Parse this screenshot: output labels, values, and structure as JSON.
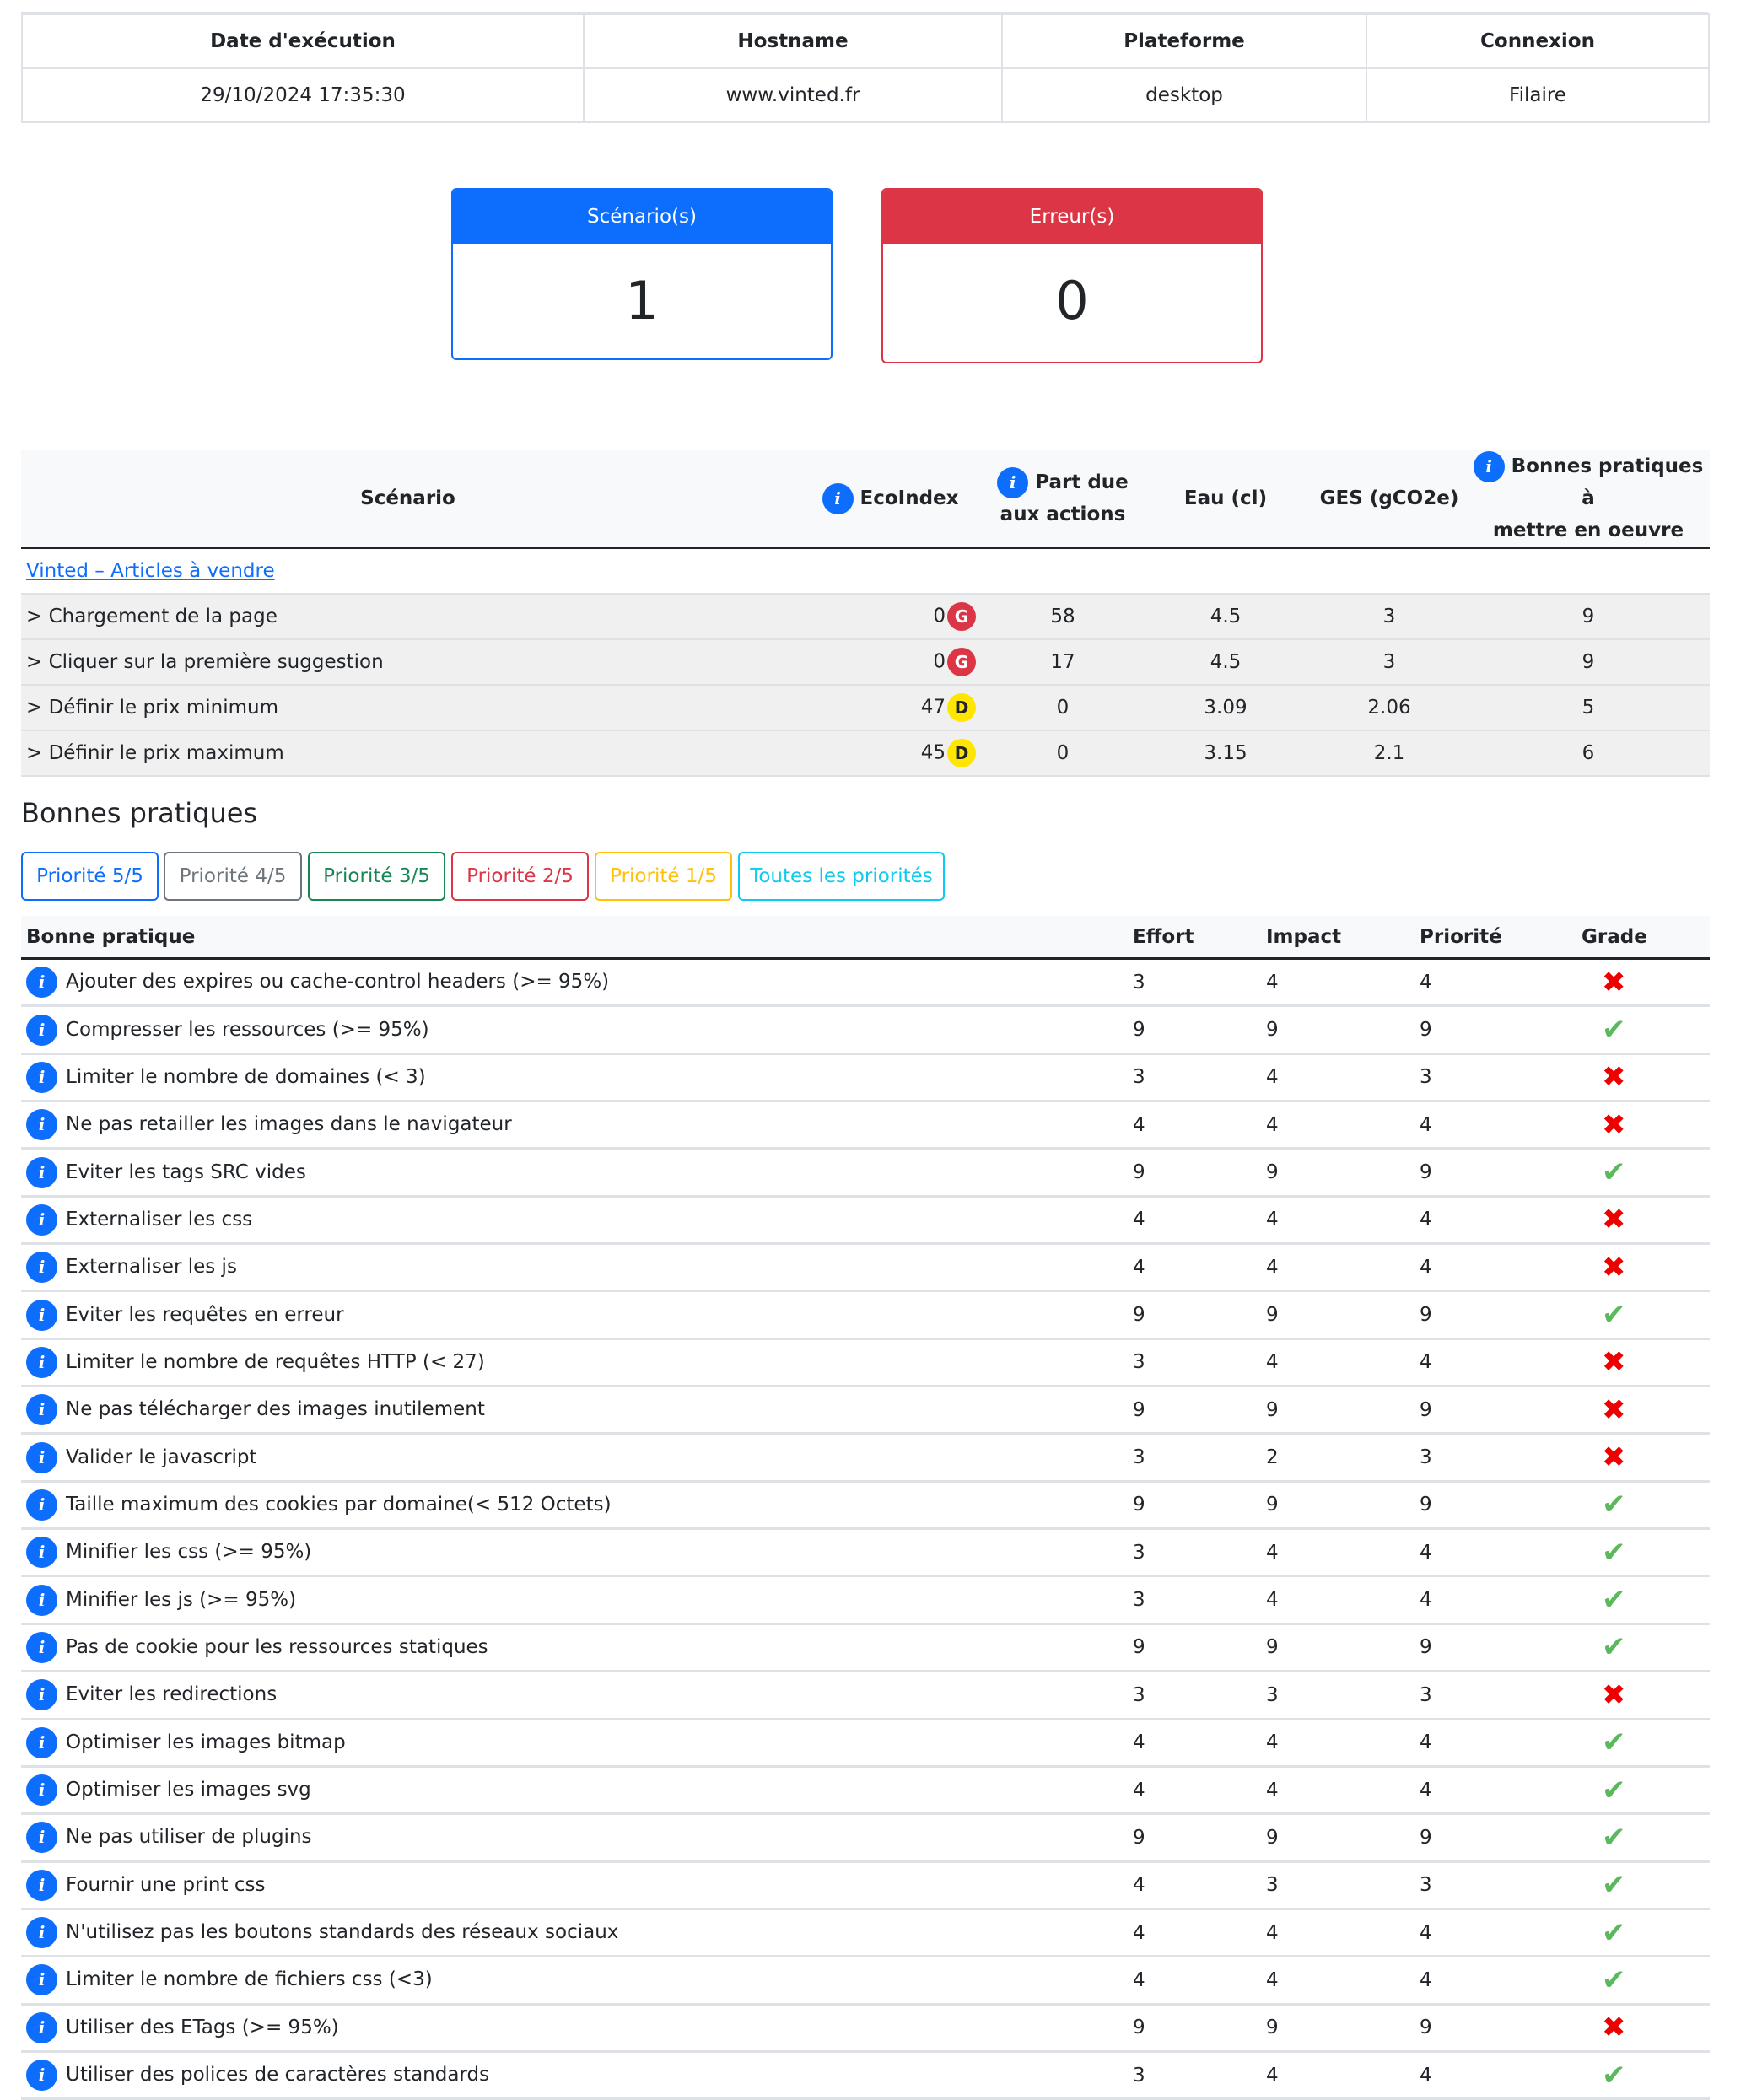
{
  "info": {
    "headers": [
      "Date d'exécution",
      "Hostname",
      "Plateforme",
      "Connexion"
    ],
    "values": [
      "29/10/2024 17:35:30",
      "www.vinted.fr",
      "desktop",
      "Filaire"
    ]
  },
  "counters": {
    "scenarios": {
      "label": "Scénario(s)",
      "value": "1",
      "color": "#0d6efd"
    },
    "errors": {
      "label": "Erreur(s)",
      "value": "0",
      "color": "#dc3545"
    }
  },
  "scenario_table": {
    "headers": {
      "scenario": "Scénario",
      "ecoindex": "EcoIndex",
      "part_line1": "Part due",
      "part_line2": "aux actions",
      "water": "Eau (cl)",
      "ges": "GES (gCO2e)",
      "bp_line1": "Bonnes pratiques à",
      "bp_line2": "mettre en oeuvre"
    },
    "scenario_name": "Vinted – Articles à vendre",
    "steps": [
      {
        "name": "> Chargement de la page",
        "ecoindex": "0",
        "grade": "G",
        "grade_color": "#dc3545",
        "part": "58",
        "water": "4.5",
        "ges": "3",
        "bp": "9"
      },
      {
        "name": "> Cliquer sur la première suggestion",
        "ecoindex": "0",
        "grade": "G",
        "grade_color": "#dc3545",
        "part": "17",
        "water": "4.5",
        "ges": "3",
        "bp": "9"
      },
      {
        "name": "> Définir le prix minimum",
        "ecoindex": "47",
        "grade": "D",
        "grade_color": "#ffe600",
        "part": "0",
        "water": "3.09",
        "ges": "2.06",
        "bp": "5"
      },
      {
        "name": "> Définir le prix maximum",
        "ecoindex": "45",
        "grade": "D",
        "grade_color": "#ffe600",
        "part": "0",
        "water": "3.15",
        "ges": "2.1",
        "bp": "6"
      }
    ]
  },
  "good_practices": {
    "title": "Bonnes pratiques",
    "filters": [
      {
        "label": "Priorité 5/5",
        "color": "#0d6efd"
      },
      {
        "label": "Priorité 4/5",
        "color": "#6c757d"
      },
      {
        "label": "Priorité 3/5",
        "color": "#198754"
      },
      {
        "label": "Priorité 2/5",
        "color": "#dc3545"
      },
      {
        "label": "Priorité 1/5",
        "color": "#ffc107"
      },
      {
        "label": "Toutes les priorités",
        "color": "#0dcaf0"
      }
    ],
    "headers": {
      "practice": "Bonne pratique",
      "effort": "Effort",
      "impact": "Impact",
      "priority": "Priorité",
      "grade": "Grade"
    },
    "rows": [
      {
        "name": "Ajouter des expires ou cache-control headers (>= 95%)",
        "effort": "3",
        "impact": "4",
        "priority": "4",
        "grade": "fail"
      },
      {
        "name": "Compresser les ressources (>= 95%)",
        "effort": "9",
        "impact": "9",
        "priority": "9",
        "grade": "ok"
      },
      {
        "name": "Limiter le nombre de domaines (< 3)",
        "effort": "3",
        "impact": "4",
        "priority": "3",
        "grade": "fail"
      },
      {
        "name": "Ne pas retailler les images dans le navigateur",
        "effort": "4",
        "impact": "4",
        "priority": "4",
        "grade": "fail"
      },
      {
        "name": "Eviter les tags SRC vides",
        "effort": "9",
        "impact": "9",
        "priority": "9",
        "grade": "ok"
      },
      {
        "name": "Externaliser les css",
        "effort": "4",
        "impact": "4",
        "priority": "4",
        "grade": "fail"
      },
      {
        "name": "Externaliser les js",
        "effort": "4",
        "impact": "4",
        "priority": "4",
        "grade": "fail"
      },
      {
        "name": "Eviter les requêtes en erreur",
        "effort": "9",
        "impact": "9",
        "priority": "9",
        "grade": "ok"
      },
      {
        "name": "Limiter le nombre de requêtes HTTP (< 27)",
        "effort": "3",
        "impact": "4",
        "priority": "4",
        "grade": "fail"
      },
      {
        "name": "Ne pas télécharger des images inutilement",
        "effort": "9",
        "impact": "9",
        "priority": "9",
        "grade": "fail"
      },
      {
        "name": "Valider le javascript",
        "effort": "3",
        "impact": "2",
        "priority": "3",
        "grade": "fail"
      },
      {
        "name": "Taille maximum des cookies par domaine(< 512 Octets)",
        "effort": "9",
        "impact": "9",
        "priority": "9",
        "grade": "ok"
      },
      {
        "name": "Minifier les css (>= 95%)",
        "effort": "3",
        "impact": "4",
        "priority": "4",
        "grade": "ok"
      },
      {
        "name": "Minifier les js (>= 95%)",
        "effort": "3",
        "impact": "4",
        "priority": "4",
        "grade": "ok"
      },
      {
        "name": "Pas de cookie pour les ressources statiques",
        "effort": "9",
        "impact": "9",
        "priority": "9",
        "grade": "ok"
      },
      {
        "name": "Eviter les redirections",
        "effort": "3",
        "impact": "3",
        "priority": "3",
        "grade": "fail"
      },
      {
        "name": "Optimiser les images bitmap",
        "effort": "4",
        "impact": "4",
        "priority": "4",
        "grade": "ok"
      },
      {
        "name": "Optimiser les images svg",
        "effort": "4",
        "impact": "4",
        "priority": "4",
        "grade": "ok"
      },
      {
        "name": "Ne pas utiliser de plugins",
        "effort": "9",
        "impact": "9",
        "priority": "9",
        "grade": "ok"
      },
      {
        "name": "Fournir une print css",
        "effort": "4",
        "impact": "3",
        "priority": "3",
        "grade": "ok"
      },
      {
        "name": "N'utilisez pas les boutons standards des réseaux sociaux",
        "effort": "4",
        "impact": "4",
        "priority": "4",
        "grade": "ok"
      },
      {
        "name": "Limiter le nombre de fichiers css (<3)",
        "effort": "4",
        "impact": "4",
        "priority": "4",
        "grade": "ok"
      },
      {
        "name": "Utiliser des ETags (>= 95%)",
        "effort": "9",
        "impact": "9",
        "priority": "9",
        "grade": "fail"
      },
      {
        "name": "Utiliser des polices de caractères standards",
        "effort": "3",
        "impact": "4",
        "priority": "4",
        "grade": "ok"
      }
    ]
  }
}
